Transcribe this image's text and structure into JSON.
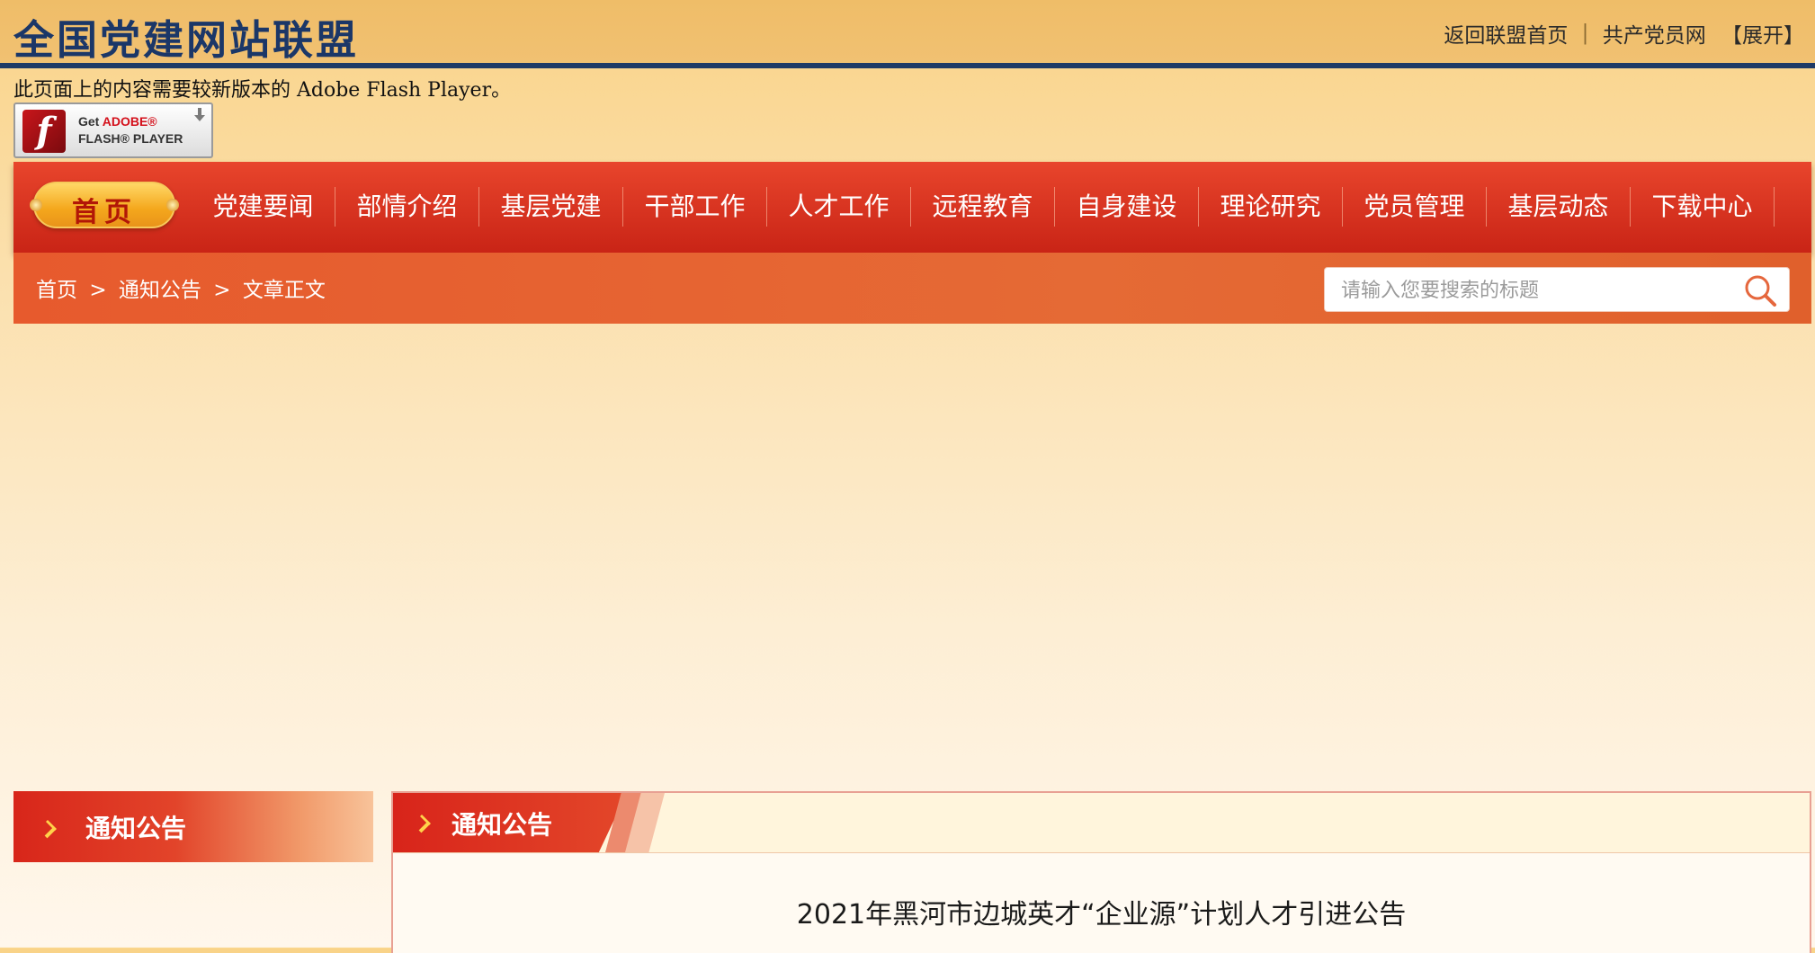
{
  "header": {
    "site_title": "全国党建网站联盟",
    "links": [
      "返回联盟首页",
      "共产党员网"
    ],
    "separator": "|",
    "expand_label": "【展开】"
  },
  "flash": {
    "message": "此页面上的内容需要较新版本的 Adobe Flash Player。",
    "badge_logo": "f",
    "badge_line1_prefix": "Get ",
    "badge_line1_brand": "ADOBE®",
    "badge_line2": "FLASH® PLAYER"
  },
  "nav": {
    "home_label": "首页",
    "items": [
      "党建要闻",
      "部情介绍",
      "基层党建",
      "干部工作",
      "人才工作",
      "远程教育",
      "自身建设",
      "理论研究",
      "党员管理",
      "基层动态",
      "下载中心"
    ]
  },
  "breadcrumb": {
    "items": [
      "首页",
      ">",
      "通知公告",
      ">",
      "文章正文"
    ]
  },
  "search": {
    "placeholder": "请输入您要搜索的标题",
    "icon": "search-icon"
  },
  "left_panel": {
    "title": "通知公告",
    "icon": "party-emblem-icon"
  },
  "right_panel": {
    "title": "通知公告",
    "icon": "party-emblem-icon",
    "article_title": "2021年黑河市边城英才“企业源”计划人才引进公告"
  },
  "colors": {
    "header_bg": "#f0bf6c",
    "title_blue": "#1b3768",
    "nav_red": "#d8301d",
    "crumb_orange": "#e5622f",
    "home_gold": "#f4a71c"
  }
}
